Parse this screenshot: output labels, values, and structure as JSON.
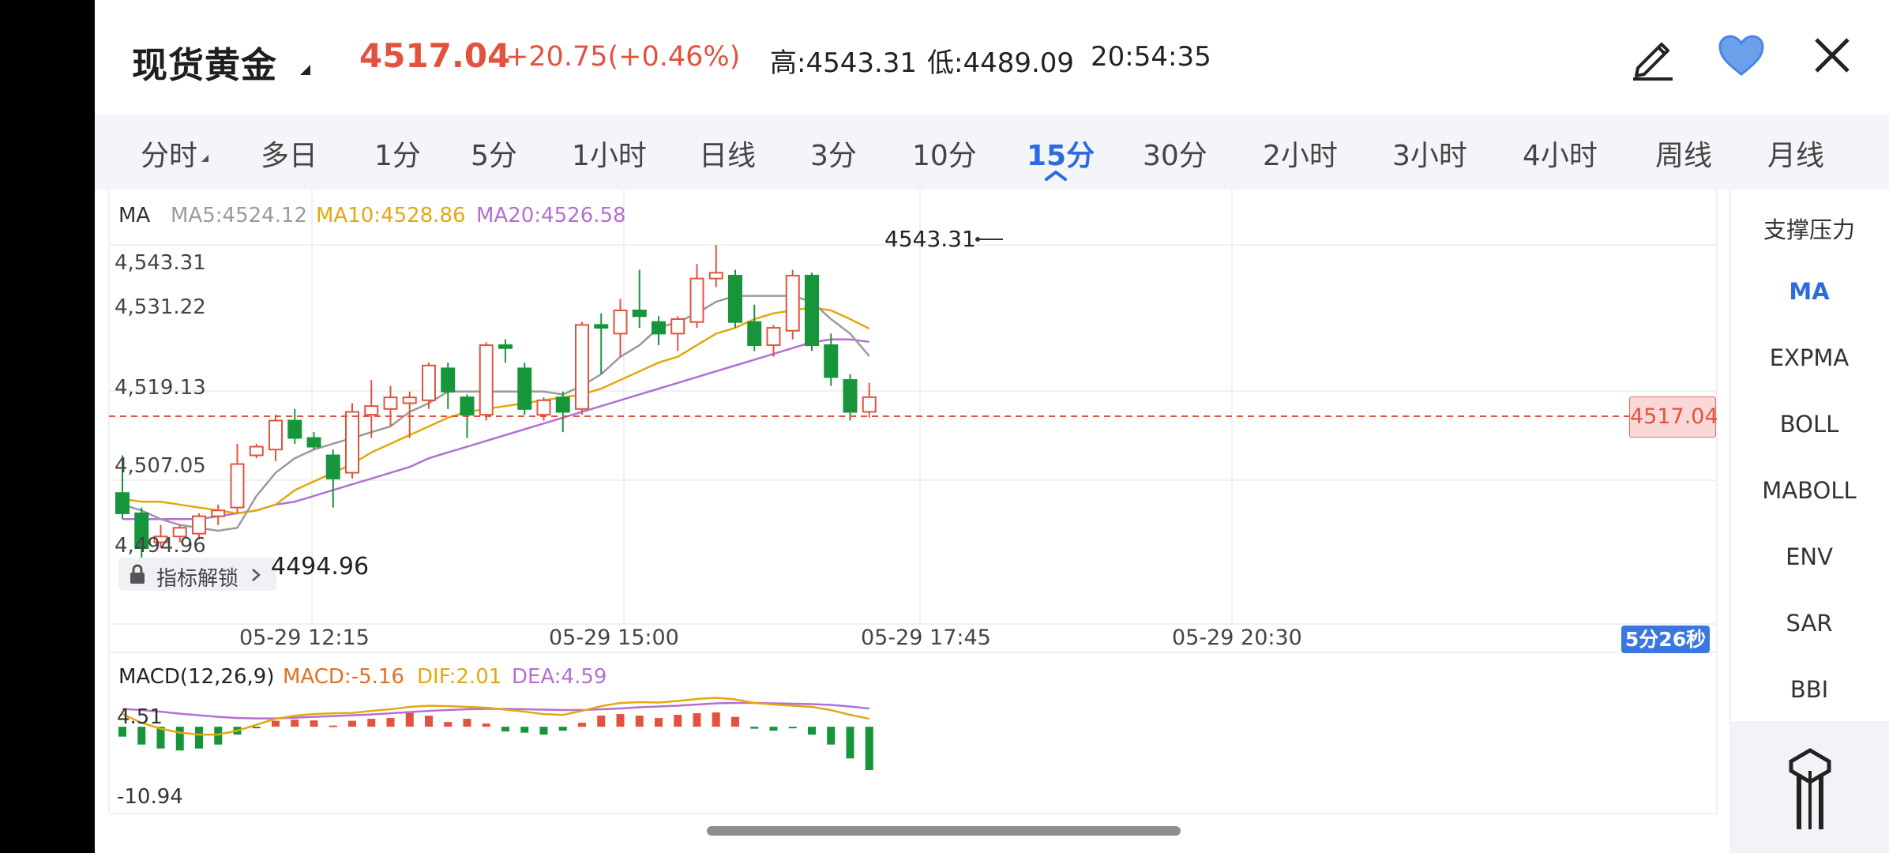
{
  "header": {
    "title": "现货黄金",
    "price": "4517.04",
    "change": "+20.75(+0.46%)",
    "high": "高:4543.31",
    "low": "低:4489.09",
    "time": "20:54:35",
    "icons": [
      "edit-icon",
      "heart-icon",
      "close-icon"
    ]
  },
  "tabs": [
    {
      "label": "分时"
    },
    {
      "label": "多日"
    },
    {
      "label": "1分"
    },
    {
      "label": "5分"
    },
    {
      "label": "1小时"
    },
    {
      "label": "日线"
    },
    {
      "label": "3分"
    },
    {
      "label": "10分"
    },
    {
      "label": "15分",
      "active": true
    },
    {
      "label": "30分"
    },
    {
      "label": "2小时"
    },
    {
      "label": "3小时"
    },
    {
      "label": "4小时"
    },
    {
      "label": "周线"
    },
    {
      "label": "月线"
    }
  ],
  "chart": {
    "ma_label": "MA",
    "ma5": "MA5:4524.12",
    "ma10": "MA10:4528.86",
    "ma20": "MA20:4526.58",
    "y_labels": [
      "4,543.31",
      "4,531.22",
      "4,519.13",
      "4,507.05",
      "4,494.96"
    ],
    "x_labels": [
      "05-29 12:15",
      "05-29 15:00",
      "05-29 17:45",
      "05-29 20:30"
    ],
    "high_marker": "4543.31",
    "low_marker": "4494.96",
    "current_price_tag": "4517.04",
    "countdown": "5分26秒",
    "unlock_label": "指标解锁",
    "colors": {
      "up": "#e1533f",
      "down": "#17953a",
      "ma5": "#9a9a9a",
      "ma10": "#e3a80f",
      "ma20": "#b46fd0",
      "accent": "#2d6be0"
    }
  },
  "macd": {
    "label": "MACD(12,26,9)",
    "macd": "MACD:-5.16",
    "dif": "DIF:2.01",
    "dea": "DEA:4.59",
    "y_top": "4.51",
    "y_bottom": "-10.94"
  },
  "side_panel": {
    "items": [
      {
        "label": "支撑压力"
      },
      {
        "label": "MA",
        "active": true
      },
      {
        "label": "EXPMA"
      },
      {
        "label": "BOLL"
      },
      {
        "label": "MABOLL"
      },
      {
        "label": "ENV"
      },
      {
        "label": "SAR"
      },
      {
        "label": "BBI"
      }
    ]
  },
  "chart_data": {
    "type": "candlestick",
    "ylim": [
      4489.09,
      4543.31
    ],
    "candles": [
      {
        "o": 4500.5,
        "h": 4507.0,
        "c": 4497.0,
        "l": 4496.0
      },
      {
        "o": 4497.0,
        "h": 4498.0,
        "c": 4491.0,
        "l": 4489.09
      },
      {
        "o": 4492.0,
        "h": 4495.0,
        "c": 4493.0,
        "l": 4491.0
      },
      {
        "o": 4493.0,
        "h": 4494.96,
        "c": 4494.5,
        "l": 4492.0
      },
      {
        "o": 4493.5,
        "h": 4497.0,
        "c": 4496.5,
        "l": 4492.5
      },
      {
        "o": 4496.5,
        "h": 4498.5,
        "c": 4497.5,
        "l": 4495.0
      },
      {
        "o": 4498.0,
        "h": 4509.0,
        "c": 4505.5,
        "l": 4497.0
      },
      {
        "o": 4507.0,
        "h": 4509.0,
        "c": 4508.5,
        "l": 4506.5
      },
      {
        "o": 4508.0,
        "h": 4514.0,
        "c": 4513.0,
        "l": 4506.0
      },
      {
        "o": 4513.0,
        "h": 4515.0,
        "c": 4510.0,
        "l": 4509.0
      },
      {
        "o": 4510.0,
        "h": 4511.0,
        "c": 4508.5,
        "l": 4508.0
      },
      {
        "o": 4507.0,
        "h": 4508.0,
        "c": 4503.0,
        "l": 4498.0
      },
      {
        "o": 4504.0,
        "h": 4516.0,
        "c": 4514.5,
        "l": 4503.0
      },
      {
        "o": 4514.0,
        "h": 4520.0,
        "c": 4515.5,
        "l": 4510.0
      },
      {
        "o": 4515.0,
        "h": 4519.0,
        "c": 4517.0,
        "l": 4512.0
      },
      {
        "o": 4516.0,
        "h": 4518.0,
        "c": 4517.0,
        "l": 4510.0
      },
      {
        "o": 4516.5,
        "h": 4523.0,
        "c": 4522.5,
        "l": 4515.0
      },
      {
        "o": 4522.0,
        "h": 4523.0,
        "c": 4518.0,
        "l": 4515.0
      },
      {
        "o": 4517.0,
        "h": 4517.5,
        "c": 4514.0,
        "l": 4510.0
      },
      {
        "o": 4514.0,
        "h": 4526.5,
        "c": 4526.0,
        "l": 4513.0
      },
      {
        "o": 4526.0,
        "h": 4527.0,
        "c": 4525.5,
        "l": 4523.0
      },
      {
        "o": 4522.0,
        "h": 4523.0,
        "c": 4515.0,
        "l": 4514.0
      },
      {
        "o": 4514.0,
        "h": 4517.0,
        "c": 4516.5,
        "l": 4513.0
      },
      {
        "o": 4517.0,
        "h": 4518.0,
        "c": 4514.5,
        "l": 4511.0
      },
      {
        "o": 4515.0,
        "h": 4530.0,
        "c": 4529.5,
        "l": 4514.0
      },
      {
        "o": 4529.5,
        "h": 4531.5,
        "c": 4529.0,
        "l": 4521.0
      },
      {
        "o": 4528.0,
        "h": 4534.0,
        "c": 4532.0,
        "l": 4524.0
      },
      {
        "o": 4532.0,
        "h": 4539.0,
        "c": 4531.0,
        "l": 4529.0
      },
      {
        "o": 4530.0,
        "h": 4531.0,
        "c": 4528.0,
        "l": 4526.0
      },
      {
        "o": 4528.0,
        "h": 4531.0,
        "c": 4530.5,
        "l": 4525.0
      },
      {
        "o": 4530.0,
        "h": 4540.0,
        "c": 4537.5,
        "l": 4529.0
      },
      {
        "o": 4537.5,
        "h": 4543.31,
        "c": 4538.5,
        "l": 4536.0
      },
      {
        "o": 4538.0,
        "h": 4539.0,
        "c": 4530.0,
        "l": 4529.0
      },
      {
        "o": 4530.0,
        "h": 4533.0,
        "c": 4526.0,
        "l": 4525.0
      },
      {
        "o": 4526.0,
        "h": 4529.5,
        "c": 4529.0,
        "l": 4524.0
      },
      {
        "o": 4528.5,
        "h": 4539.0,
        "c": 4538.0,
        "l": 4527.0
      },
      {
        "o": 4538.0,
        "h": 4538.5,
        "c": 4526.0,
        "l": 4525.0
      },
      {
        "o": 4526.0,
        "h": 4528.0,
        "c": 4520.5,
        "l": 4519.0
      },
      {
        "o": 4520.0,
        "h": 4521.0,
        "c": 4514.5,
        "l": 4513.0
      },
      {
        "o": 4514.5,
        "h": 4519.5,
        "c": 4517.04,
        "l": 4513.5
      }
    ],
    "ma5": [
      4498.5,
      4497.5,
      4496.0,
      4495.0,
      4494.5,
      4494.0,
      4494.5,
      4500.0,
      4504.0,
      4506.5,
      4508.0,
      4509.0,
      4510.0,
      4511.0,
      4512.0,
      4514.5,
      4516.0,
      4518.0,
      4518.0,
      4518.0,
      4518.0,
      4518.0,
      4518.0,
      4517.5,
      4519.0,
      4521.0,
      4524.0,
      4526.0,
      4529.0,
      4530.0,
      4531.5,
      4533.5,
      4534.5,
      4534.5,
      4534.5,
      4534.5,
      4533.5,
      4530.5,
      4528.0,
      4524.12
    ],
    "ma10": [
      4499.5,
      4499.0,
      4499.0,
      4498.5,
      4498.0,
      4497.5,
      4497.0,
      4497.5,
      4498.5,
      4501.0,
      4502.5,
      4504.0,
      4505.5,
      4507.5,
      4509.0,
      4510.5,
      4512.0,
      4513.5,
      4514.5,
      4515.0,
      4515.5,
      4516.0,
      4516.5,
      4517.0,
      4517.5,
      4518.5,
      4520.0,
      4521.5,
      4523.0,
      4524.0,
      4526.0,
      4528.0,
      4529.0,
      4530.5,
      4531.5,
      4532.0,
      4532.5,
      4532.0,
      4530.5,
      4528.86
    ],
    "ma20": [
      4496.0,
      4496.0,
      4496.0,
      4496.0,
      4496.0,
      4496.5,
      4497.0,
      4497.5,
      4498.5,
      4499.0,
      4500.0,
      4501.0,
      4502.0,
      4503.0,
      4504.0,
      4505.0,
      4506.5,
      4507.5,
      4508.5,
      4509.5,
      4510.5,
      4511.5,
      4512.5,
      4513.5,
      4514.5,
      4515.5,
      4516.5,
      4517.5,
      4518.5,
      4519.5,
      4520.5,
      4521.5,
      4522.5,
      4523.5,
      4524.5,
      4525.5,
      4526.5,
      4527.0,
      4527.0,
      4526.58
    ],
    "macd_hist": [
      -2.5,
      -4.5,
      -5.5,
      -6.0,
      -5.5,
      -4.5,
      -2.0,
      -0.3,
      1.5,
      1.8,
      1.6,
      0.3,
      1.5,
      2.0,
      2.2,
      3.5,
      2.8,
      1.2,
      2.0,
      0.8,
      -1.2,
      -1.5,
      -2.0,
      -1.0,
      1.0,
      2.8,
      3.2,
      2.8,
      2.2,
      3.0,
      3.4,
      3.6,
      2.5,
      -0.5,
      -1.0,
      -0.2,
      -2.0,
      -4.5,
      -8.0,
      -10.94
    ],
    "dif": [
      3.2,
      1.0,
      -0.5,
      -1.5,
      -2.0,
      -2.0,
      -1.0,
      0.5,
      2.0,
      2.8,
      3.2,
      3.4,
      3.5,
      4.0,
      4.4,
      5.0,
      5.3,
      5.2,
      5.0,
      4.8,
      4.3,
      3.8,
      3.2,
      3.0,
      4.0,
      5.2,
      6.0,
      6.2,
      6.1,
      6.5,
      7.0,
      7.3,
      6.9,
      6.0,
      5.6,
      5.3,
      5.0,
      4.2,
      3.0,
      2.01
    ],
    "dea": [
      4.51,
      4.2,
      3.8,
      3.3,
      2.9,
      2.5,
      2.2,
      2.1,
      2.1,
      2.3,
      2.5,
      2.7,
      2.9,
      3.1,
      3.4,
      3.7,
      4.0,
      4.2,
      4.4,
      4.5,
      4.5,
      4.4,
      4.3,
      4.2,
      4.2,
      4.4,
      4.6,
      4.9,
      5.1,
      5.3,
      5.6,
      5.9,
      6.0,
      6.0,
      5.9,
      5.8,
      5.7,
      5.5,
      5.1,
      4.59
    ]
  }
}
